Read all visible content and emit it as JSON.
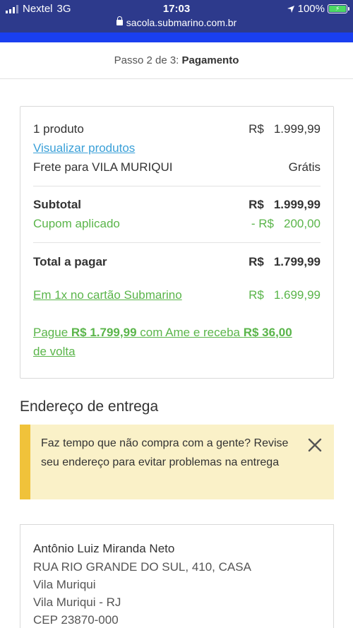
{
  "status_bar": {
    "carrier": "Nextel",
    "network": "3G",
    "time": "17:03",
    "battery": "100%",
    "url": "sacola.submarino.com.br"
  },
  "checkout_step": {
    "prefix": "Passo 2 de 3:",
    "current": "Pagamento"
  },
  "summary": {
    "products_label": "1 produto",
    "products_currency": "R$",
    "products_value": "1.999,99",
    "view_products_link": "Visualizar produtos",
    "shipping_label": "Frete para VILA MURIQUI",
    "shipping_value": "Grátis",
    "subtotal_label": "Subtotal",
    "subtotal_currency": "R$",
    "subtotal_value": "1.999,99",
    "coupon_label": "Cupom aplicado",
    "coupon_currency": "- R$",
    "coupon_value": "200,00",
    "total_label": "Total a pagar",
    "total_currency": "R$",
    "total_value": "1.799,99",
    "card_offer_label": "Em 1x no cartão Submarino",
    "card_offer_currency": "R$",
    "card_offer_value": "1.699,99",
    "ame_prefix": "Pague ",
    "ame_amount": "R$ 1.799,99",
    "ame_middle": " com Ame e receba ",
    "ame_cashback": "R$ 36,00",
    "ame_suffix": "de volta"
  },
  "delivery": {
    "title": "Endereço de entrega",
    "alert_text": "Faz tempo que não compra com a gente? Revise seu endereço para evitar problemas na entrega",
    "address": {
      "name": "Antônio Luiz Miranda Neto",
      "street": "RUA RIO GRANDE DO SUL, 410, CASA",
      "neighborhood": "Vila Muriqui",
      "city_state": "Vila Muriqui - RJ",
      "zip": "CEP 23870-000"
    }
  },
  "colors": {
    "status_bar": "#2d3a8c",
    "brand_blue": "#1a3ff0",
    "green": "#5ab54a",
    "link_blue": "#3aa0d8",
    "alert_bg": "#faf1c8",
    "alert_bar": "#f0c23a"
  },
  "icons": [
    "signal-icon",
    "location-arrow-icon",
    "battery-icon",
    "lock-icon",
    "close-icon"
  ]
}
